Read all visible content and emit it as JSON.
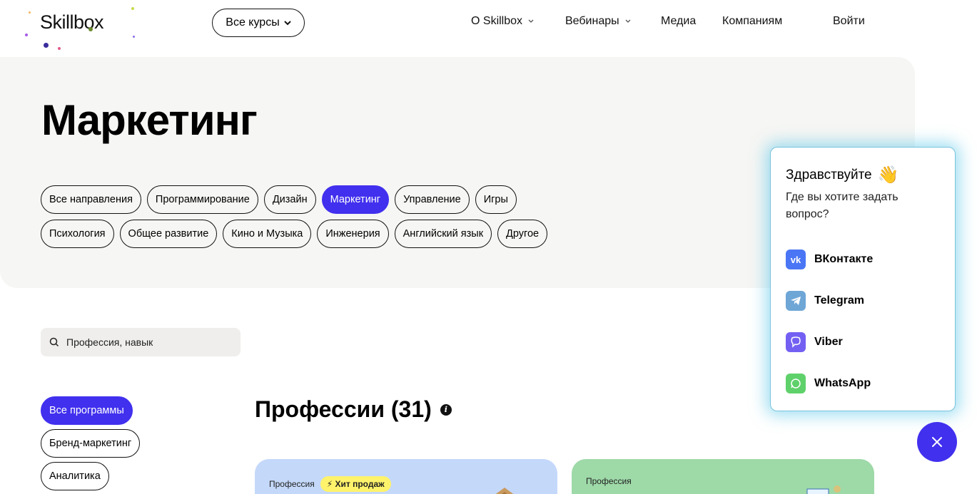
{
  "header": {
    "logo": "Skillbox",
    "all_courses": "Все курсы",
    "nav": [
      {
        "label": "О Skillbox"
      },
      {
        "label": "Вебинары"
      },
      {
        "label": "Медиа"
      },
      {
        "label": "Компаниям"
      }
    ],
    "login": "Войти"
  },
  "hero": {
    "title": "Маркетинг",
    "directions_row1": [
      "Все направления",
      "Программирование",
      "Дизайн",
      "Маркетинг",
      "Управление",
      "Игры"
    ],
    "directions_row2": [
      "Психология",
      "Общее развитие",
      "Кино и Музыка",
      "Инженерия",
      "Английский язык",
      "Другое"
    ],
    "active_direction": "Маркетинг"
  },
  "search": {
    "placeholder": "Профессия, навык"
  },
  "filters": [
    "Все программы",
    "Бренд-маркетинг",
    "Аналитика"
  ],
  "section": {
    "title": "Профессии (31)"
  },
  "cards": [
    {
      "type_label": "Профессия",
      "badge": "Хит продаж"
    },
    {
      "type_label": "Профессия"
    }
  ],
  "chat": {
    "greeting": "Здравствуйте",
    "question": "Где вы хотите задать вопрос?",
    "messengers": [
      {
        "name": "ВКонтакте",
        "icon": "vk-icon",
        "color": "#4a76f5"
      },
      {
        "name": "Telegram",
        "icon": "telegram-icon",
        "color": "#6ea6d6"
      },
      {
        "name": "Viber",
        "icon": "viber-icon",
        "color": "#7360f2"
      },
      {
        "name": "WhatsApp",
        "icon": "whatsapp-icon",
        "color": "#5fd16b"
      }
    ]
  },
  "colors": {
    "accent": "#4130ee",
    "hero_bg": "#f6f6f4",
    "badge": "#fff36b"
  }
}
